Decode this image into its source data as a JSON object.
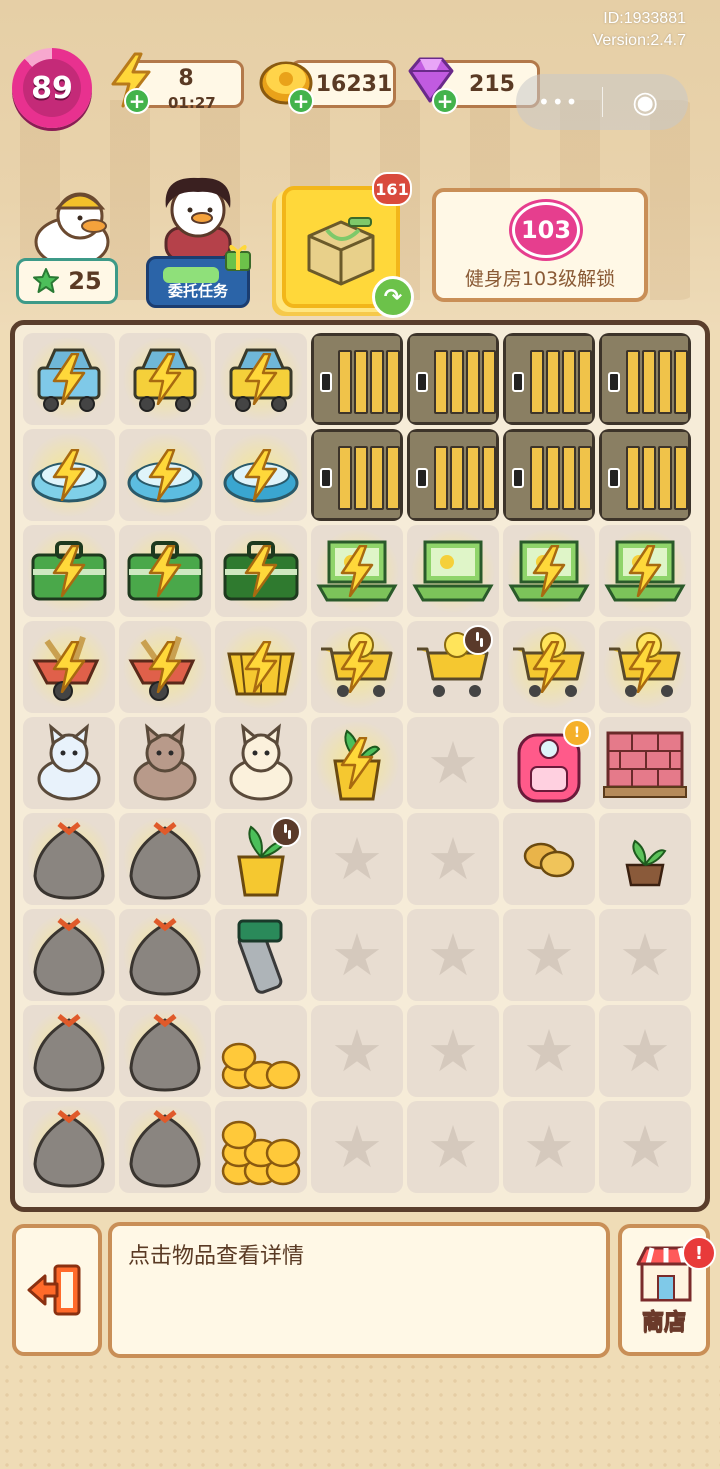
{
  "system": {
    "id_text": "ID:1933881",
    "version_text": "Version:2.4.7"
  },
  "header": {
    "level": "89",
    "energy": {
      "value": "8",
      "timer": "01:27",
      "icon": "lightning-icon"
    },
    "coins": {
      "value": "16231",
      "icon": "coin-icon"
    },
    "gems": {
      "value": "215",
      "icon": "gem-icon"
    },
    "plus_symbol": "+",
    "capsule": {
      "more_glyph": "•••",
      "close_glyph": "◉"
    }
  },
  "characters": {
    "worker_star_count": "25",
    "commission_label": "委托任务"
  },
  "featured_item": {
    "count": "161",
    "arrow": "↷"
  },
  "unlock_panel": {
    "level": "103",
    "text": "健身房103级解锁"
  },
  "board": {
    "columns": 7,
    "rows": [
      [
        "cart_blue",
        "cart_green",
        "cart_yellow",
        "cabinet",
        "cabinet",
        "cabinet",
        "cabinet"
      ],
      [
        "robot_vac_lvl1",
        "robot_vac_lvl2",
        "robot_vac_lvl3",
        "cabinet",
        "cabinet",
        "cabinet",
        "cabinet"
      ],
      [
        "toolbox_green",
        "toolbox_green",
        "toolbox_dark",
        "laptop",
        "laptop",
        "laptop",
        "laptop"
      ],
      [
        "wheelbarrow",
        "wheelbarrow",
        "basket_yellow",
        "shopping_cart_chick",
        "shopping_cart_timer",
        "shopping_cart_chick",
        "shopping_cart_chick"
      ],
      [
        "cat_white_fluffy",
        "cat_sphynx",
        "cat_sleeping",
        "plant_pot_bolt",
        "empty",
        "backpack_pink",
        "brick_pallet"
      ],
      [
        "trash_bag",
        "trash_bag",
        "plant_pot_timer",
        "empty",
        "empty",
        "potatoes",
        "seedling"
      ],
      [
        "trash_bag",
        "trash_bag",
        "wrench",
        "empty",
        "empty",
        "empty",
        "empty"
      ],
      [
        "trash_bag",
        "trash_bag",
        "coins_small",
        "empty",
        "empty",
        "empty",
        "empty"
      ],
      [
        "trash_bag",
        "trash_bag",
        "coins_pile",
        "empty",
        "empty",
        "empty",
        "empty"
      ]
    ],
    "glowing_cells": [
      "0-0",
      "0-1",
      "0-2",
      "1-0",
      "1-1",
      "1-2",
      "2-0",
      "2-1",
      "2-2",
      "2-3",
      "2-4",
      "2-5",
      "2-6",
      "3-0",
      "3-1",
      "3-2",
      "3-3",
      "3-5",
      "3-6",
      "4-3",
      "5-0",
      "5-1",
      "6-0",
      "6-1",
      "7-0",
      "7-1",
      "8-0",
      "8-1"
    ],
    "bolt_cells": [
      "0-0",
      "0-1",
      "0-2",
      "1-0",
      "1-1",
      "1-2",
      "2-0",
      "2-1",
      "2-2",
      "2-3",
      "2-5",
      "2-6",
      "3-0",
      "3-1",
      "3-2",
      "3-3",
      "3-5",
      "3-6",
      "4-3"
    ]
  },
  "footer": {
    "exit_icon": "exit-door-icon",
    "info_text": "点击物品查看详情",
    "shop_label": "商店",
    "shop_alert": "!"
  },
  "colors": {
    "accent_pink": "#e8318f",
    "board_border": "#5a3e2c",
    "panel_border": "#c98f57",
    "energy_yellow": "#ffd83a"
  }
}
